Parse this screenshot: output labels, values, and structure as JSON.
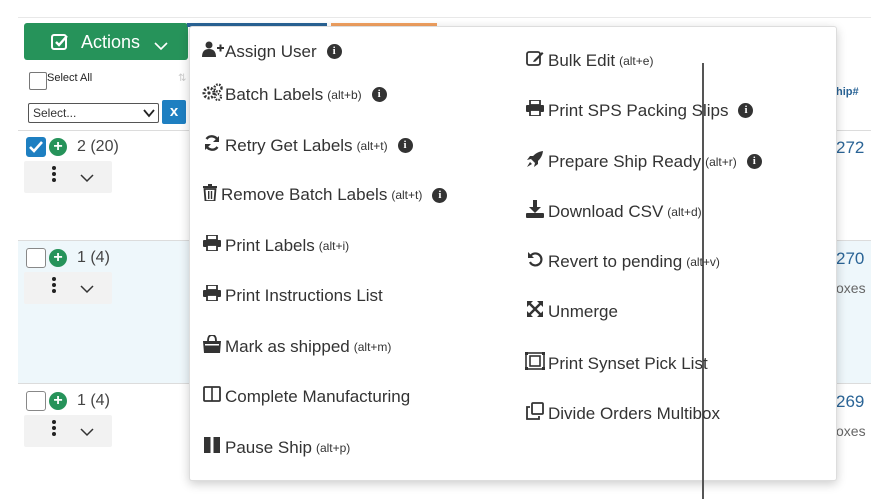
{
  "toolbar": {
    "actions_label": "Actions"
  },
  "table": {
    "select_all_label": "Select All",
    "filter_select_value": "Select...",
    "clear_button": "x",
    "ship_header": "hip#",
    "rows": [
      {
        "count": "2 (20)",
        "checked": true,
        "ship": "272",
        "boxes": ""
      },
      {
        "count": "1 (4)",
        "checked": false,
        "ship": "270",
        "boxes": "oxes"
      },
      {
        "count": "1 (4)",
        "checked": false,
        "ship": "269",
        "boxes": "oxes"
      }
    ]
  },
  "menu": {
    "left": [
      {
        "label": "Assign User",
        "shortcut": "",
        "icon": "user-plus-icon",
        "info": true
      },
      {
        "label": "Batch Labels",
        "shortcut": "(alt+b)",
        "icon": "cogs-icon",
        "info": true
      },
      {
        "label": "Retry Get Labels",
        "shortcut": "(alt+t)",
        "icon": "refresh-icon",
        "info": true
      },
      {
        "label": "Remove Batch Labels",
        "shortcut": "(alt+t)",
        "icon": "trash-icon",
        "info": true
      },
      {
        "label": "Print Labels",
        "shortcut": "(alt+i)",
        "icon": "print-icon",
        "info": false
      },
      {
        "label": "Print Instructions List",
        "shortcut": "",
        "icon": "print-icon",
        "info": false
      },
      {
        "label": "Mark as shipped",
        "shortcut": "(alt+m)",
        "icon": "shopping-bag-icon",
        "info": false
      },
      {
        "label": "Complete Manufacturing",
        "shortcut": "",
        "icon": "columns-icon",
        "info": false
      },
      {
        "label": "Pause Ship",
        "shortcut": "(alt+p)",
        "icon": "pause-icon",
        "info": false
      }
    ],
    "right": [
      {
        "label": "Bulk Edit",
        "shortcut": "(alt+e)",
        "icon": "edit-icon",
        "info": false
      },
      {
        "label": "Print SPS Packing Slips",
        "shortcut": "",
        "icon": "print-icon",
        "info": true
      },
      {
        "label": "Prepare Ship Ready",
        "shortcut": "(alt+r)",
        "icon": "rocket-icon",
        "info": true
      },
      {
        "label": "Download CSV",
        "shortcut": "(alt+d)",
        "icon": "download-icon",
        "info": false
      },
      {
        "label": "Revert to pending",
        "shortcut": "(alt+v)",
        "icon": "undo-icon",
        "info": false
      },
      {
        "label": "Unmerge",
        "shortcut": "",
        "icon": "expand-arrows-icon",
        "info": false
      },
      {
        "label": "Print Synset Pick List",
        "shortcut": "",
        "icon": "object-ungroup-icon",
        "info": false
      },
      {
        "label": "Divide Orders Multibox",
        "shortcut": "",
        "icon": "clone-icon",
        "info": false
      }
    ],
    "info_glyph": "i"
  },
  "colors": {
    "primary_green": "#26935a",
    "link_blue": "#2a6496",
    "accent_blue": "#1e7fc1",
    "orange": "#f0a060"
  }
}
